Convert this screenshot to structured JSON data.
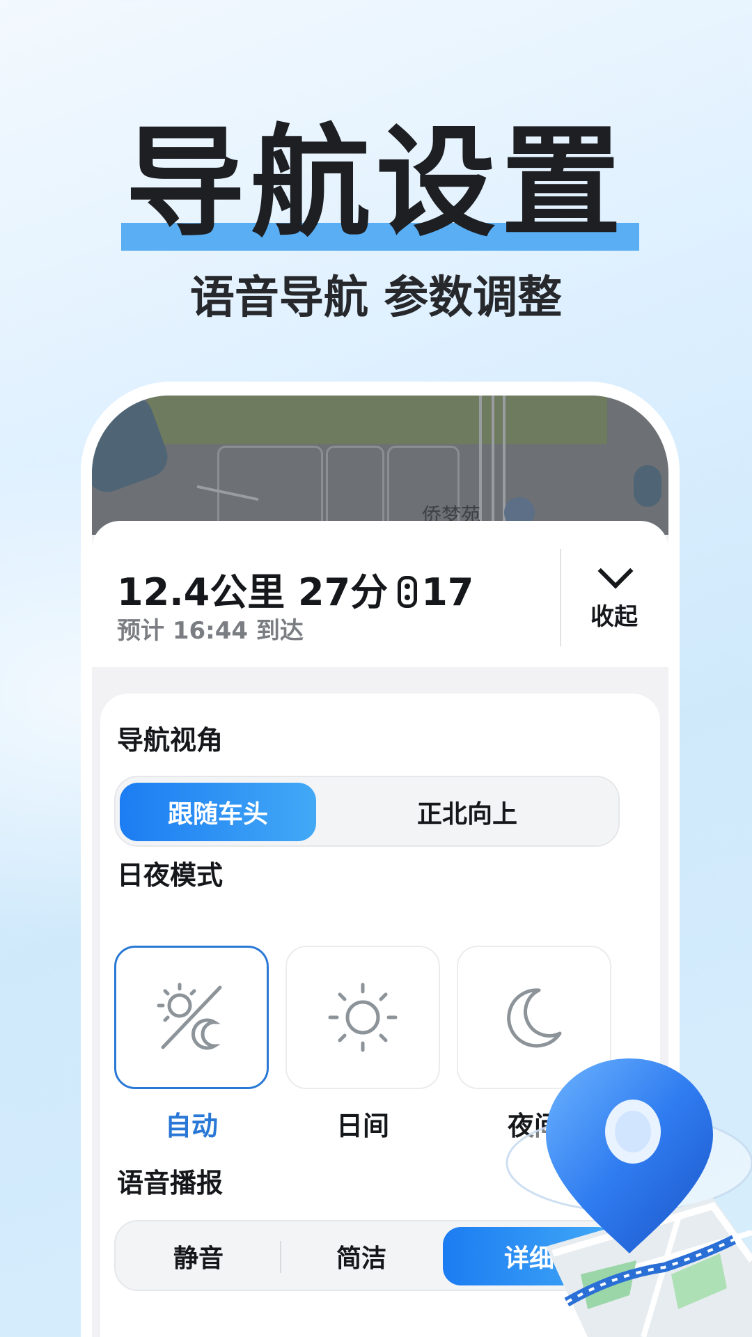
{
  "headline": {
    "title": "导航设置",
    "subtitle": "语音导航 参数调整"
  },
  "map": {
    "poi_label": "侨梦苑"
  },
  "trip": {
    "summary_left": "12.4公里 27分",
    "traffic_lights": "17",
    "eta": "预计 16:44 到达",
    "collapse_label": "收起"
  },
  "settings": {
    "view": {
      "title": "导航视角",
      "options": [
        "跟随车头",
        "正北向上"
      ],
      "selected": "跟随车头"
    },
    "day_night": {
      "title": "日夜模式",
      "options": [
        {
          "label": "自动",
          "icon": "auto-day-night-icon"
        },
        {
          "label": "日间",
          "icon": "sun-icon"
        },
        {
          "label": "夜间",
          "icon": "moon-icon"
        }
      ],
      "selected": "自动"
    },
    "voice": {
      "title": "语音播报",
      "options": [
        "静音",
        "简洁",
        "详细"
      ],
      "selected": "详细"
    }
  },
  "colors": {
    "accent": "#2a78d6",
    "accent_gradient_start": "#1c7cf2",
    "accent_gradient_end": "#42a9f6",
    "headline_bar": "#5aaef3"
  }
}
